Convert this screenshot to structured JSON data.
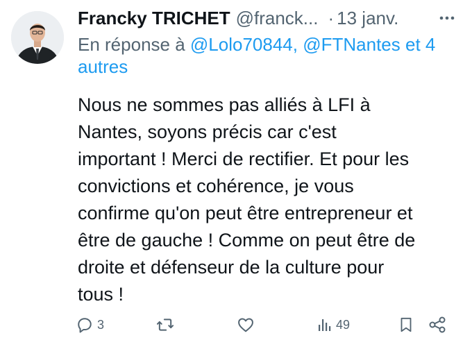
{
  "tweet": {
    "author_name": "Francky TRICHET",
    "author_handle": "@franck...",
    "separator": "·",
    "date": "13 janv.",
    "reply": {
      "prefix": "En réponse à",
      "mention_1": "@Lolo70844,",
      "mention_2": "@FTNantes",
      "connector": "et",
      "others": "4 autres"
    },
    "text_lines": [
      "Nous ne sommes pas alliés à LFI à",
      "Nantes, soyons précis car c'est",
      "important ! Merci de rectifier. Et pour les",
      "convictions et cohérence, je vous",
      "confirme qu'on peut être entrepreneur et",
      "être de gauche ! Comme on peut être de",
      "droite et défenseur de la culture pour",
      "tous !"
    ]
  },
  "actions": {
    "reply_count": "3",
    "retweet_count": "",
    "like_count": "",
    "views_count": "49"
  },
  "icons": [
    "avatar",
    "more-icon",
    "reply-icon",
    "retweet-icon",
    "like-icon",
    "views-icon",
    "bookmark-icon",
    "share-icon"
  ],
  "colors": {
    "text": "#0f1419",
    "secondary": "#536471",
    "link": "#1d9bf0",
    "background": "#ffffff"
  }
}
